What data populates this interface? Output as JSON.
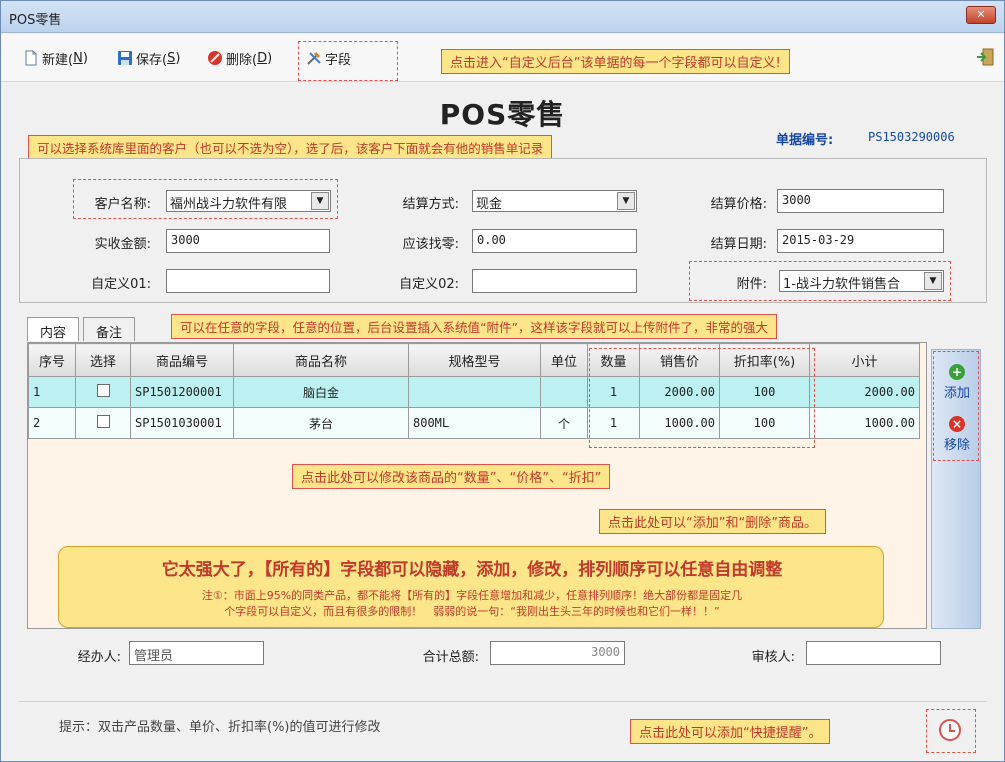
{
  "window": {
    "title": "POS零售",
    "close": "✕"
  },
  "toolbar": {
    "new_label": "新建(",
    "new_key": "N",
    "new_tail": ")",
    "save_label": "保存(",
    "save_key": "S",
    "save_tail": ")",
    "delete_label": "删除(",
    "delete_key": "D",
    "delete_tail": ")",
    "field_label": "字段"
  },
  "callouts": {
    "toolbar": "点击进入“自定义后台”该单据的每一个字段都可以自定义!",
    "customer": "可以选择系统库里面的客户（也可以不选为空），选了后，该客户下面就会有他的销售单记录",
    "attachment": "可以在任意的字段，任意的位置，后台设置插入系统值“附件”，这样该字段就可以上传附件了，非常的强大",
    "modify": "点击此处可以修改该商品的“数量”、“价格”、“折扣”",
    "add_remove": "点击此处可以“添加”和“删除”商品。",
    "big_title": "它太强大了，【所有的】字段都可以隐藏，添加，修改，排列顺序可以任意自由调整",
    "note1": "注①：市面上95%的同类产品，都不能将【所有的】字段任意增加和减少，任意排列顺序！绝大部份都是固定几",
    "note2": "个字段可以自定义，而且有很多的限制！　弱弱的说一句：“我刚出生头三年的时候也和它们一样！！”",
    "reminder": "点击此处可以添加“快捷提醒”。"
  },
  "form": {
    "title": "POS零售",
    "doc_no_label": "单据编号:",
    "doc_no": "PS1503290006",
    "customer_label": "客户名称:",
    "customer_value": "福州战斗力软件有限",
    "settle_method_label": "结算方式:",
    "settle_method_value": "现金",
    "settle_price_label": "结算价格:",
    "settle_price_value": "3000",
    "received_label": "实收金额:",
    "received_value": "3000",
    "change_label": "应该找零:",
    "change_value": "0.00",
    "settle_date_label": "结算日期:",
    "settle_date_value": "2015-03-29",
    "custom01_label": "自定义01:",
    "custom01_value": "",
    "custom02_label": "自定义02:",
    "custom02_value": "",
    "attachment_label": "附件:",
    "attachment_value": "1-战斗力软件销售合"
  },
  "tabs": [
    "内容",
    "备注"
  ],
  "grid": {
    "headers": [
      "序号",
      "选择",
      "商品编号",
      "商品名称",
      "规格型号",
      "单位",
      "数量",
      "销售价",
      "折扣率(%)",
      "小计"
    ],
    "rows": [
      {
        "no": "1",
        "code": "SP1501200001",
        "name": "脑白金",
        "spec": "",
        "unit": "",
        "qty": "1",
        "price": "2000.00",
        "discount": "100",
        "subtotal": "2000.00"
      },
      {
        "no": "2",
        "code": "SP1501030001",
        "name": "茅台",
        "spec": "800ML",
        "unit": "个",
        "qty": "1",
        "price": "1000.00",
        "discount": "100",
        "subtotal": "1000.00"
      }
    ]
  },
  "side": {
    "add_label": "添加",
    "remove_label": "移除"
  },
  "footer": {
    "handler_label": "经办人:",
    "handler_value": "管理员",
    "total_label": "合计总额:",
    "total_value": "3000",
    "auditor_label": "审核人:",
    "auditor_value": ""
  },
  "hint": "提示：双击产品数量、单价、折扣率(%)的值可进行修改",
  "colors": {
    "callout_bg": "#fde68a",
    "callout_border": "#e0534c",
    "row_highlight": "#bdf0f0",
    "accent_blue": "#1747a6"
  }
}
